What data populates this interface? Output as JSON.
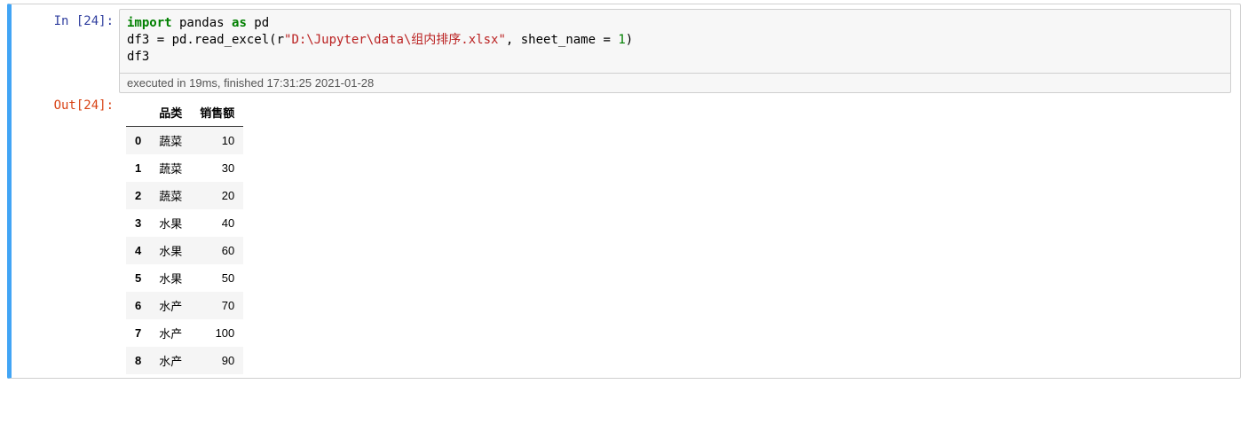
{
  "cell": {
    "in_prompt": "In  [24]:",
    "out_prompt": "Out[24]:",
    "code": {
      "kw_import": "import",
      "pandas": " pandas ",
      "kw_as": "as",
      "alias_pd": " pd",
      "l2_pre": "df3 = pd.read_excel(r",
      "l2_str": "\"D:\\Jupyter\\data\\组内排序.xlsx\"",
      "l2_mid": ", sheet_name = ",
      "l2_num": "1",
      "l2_end": ")",
      "l3": "df3"
    },
    "exec_time": "executed in 19ms, finished 17:31:25 2021-01-28",
    "table": {
      "columns": [
        "品类",
        "销售额"
      ],
      "rows": [
        {
          "idx": "0",
          "cat": "蔬菜",
          "val": "10"
        },
        {
          "idx": "1",
          "cat": "蔬菜",
          "val": "30"
        },
        {
          "idx": "2",
          "cat": "蔬菜",
          "val": "20"
        },
        {
          "idx": "3",
          "cat": "水果",
          "val": "40"
        },
        {
          "idx": "4",
          "cat": "水果",
          "val": "60"
        },
        {
          "idx": "5",
          "cat": "水果",
          "val": "50"
        },
        {
          "idx": "6",
          "cat": "水产",
          "val": "70"
        },
        {
          "idx": "7",
          "cat": "水产",
          "val": "100"
        },
        {
          "idx": "8",
          "cat": "水产",
          "val": "90"
        }
      ]
    }
  }
}
